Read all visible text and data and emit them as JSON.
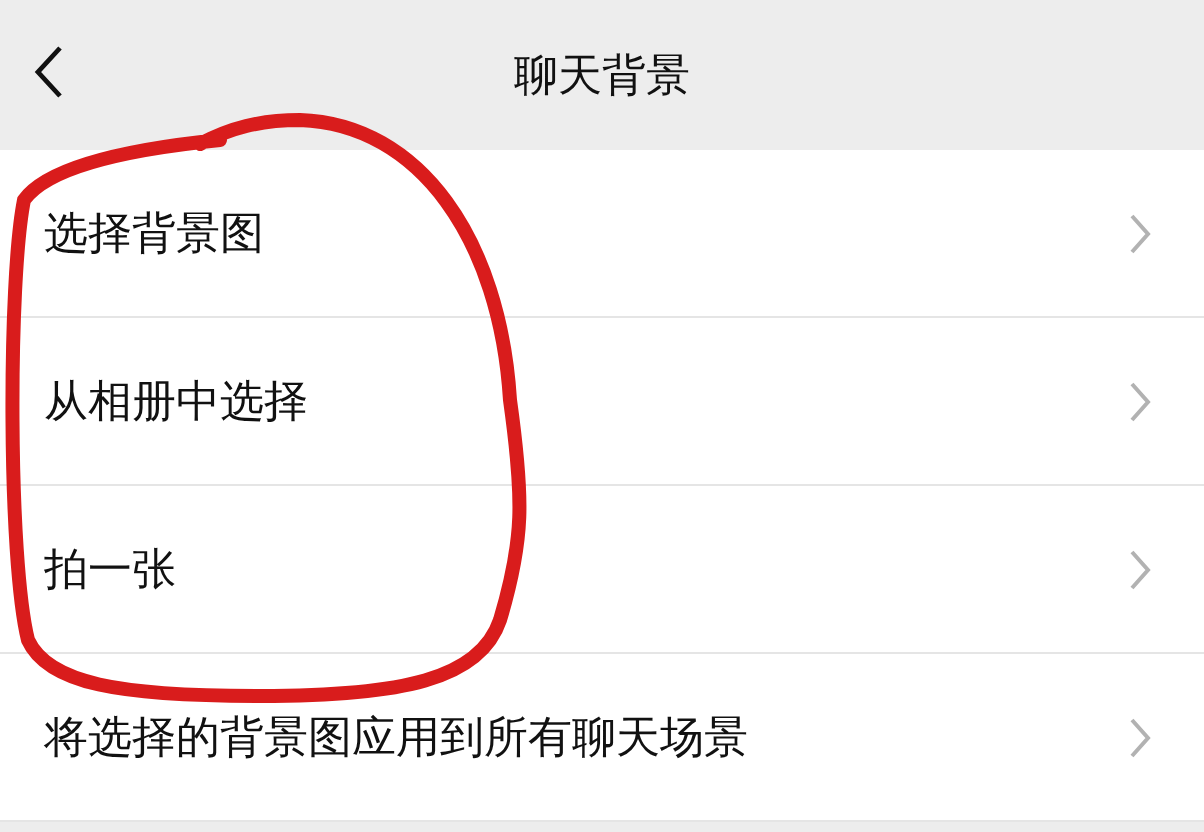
{
  "header": {
    "title": "聊天背景"
  },
  "items": [
    {
      "label": "选择背景图"
    },
    {
      "label": "从相册中选择"
    },
    {
      "label": "拍一张"
    },
    {
      "label": "将选择的背景图应用到所有聊天场景"
    }
  ]
}
